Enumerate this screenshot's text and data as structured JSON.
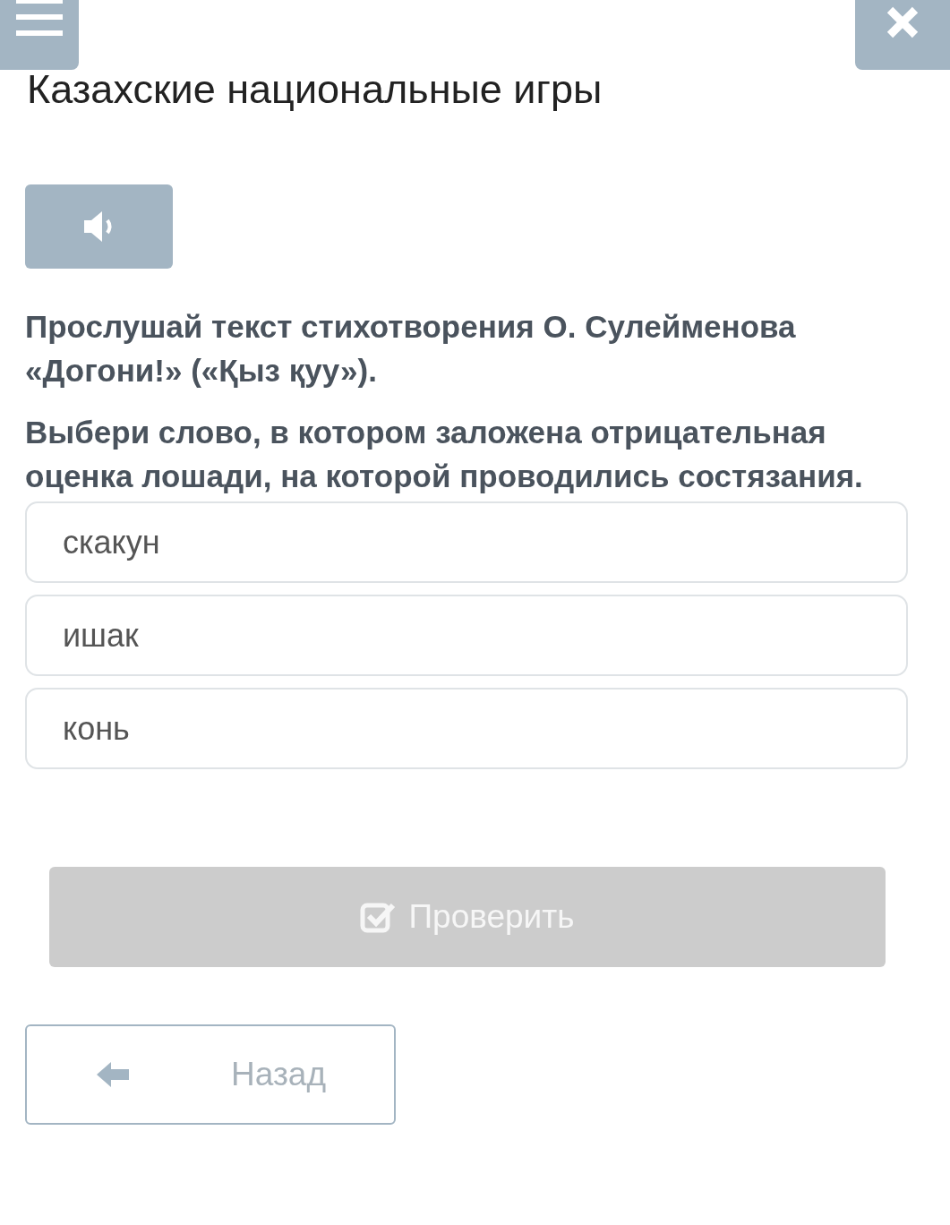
{
  "title": "Казахские национальные игры",
  "question": [
    "Прослушай текст стихотворения О. Сулейменова «Догони!» («Қыз қуу»).",
    "Выбери слово, в котором заложена отрицательная оценка лошади, на которой проводились состязания."
  ],
  "options": [
    {
      "label": "скакун",
      "selected": false
    },
    {
      "label": "ишак",
      "selected": false
    },
    {
      "label": "конь",
      "selected": false
    }
  ],
  "check_button": {
    "label": "Проверить",
    "disabled": true
  },
  "back_button": {
    "label": "Назад"
  }
}
